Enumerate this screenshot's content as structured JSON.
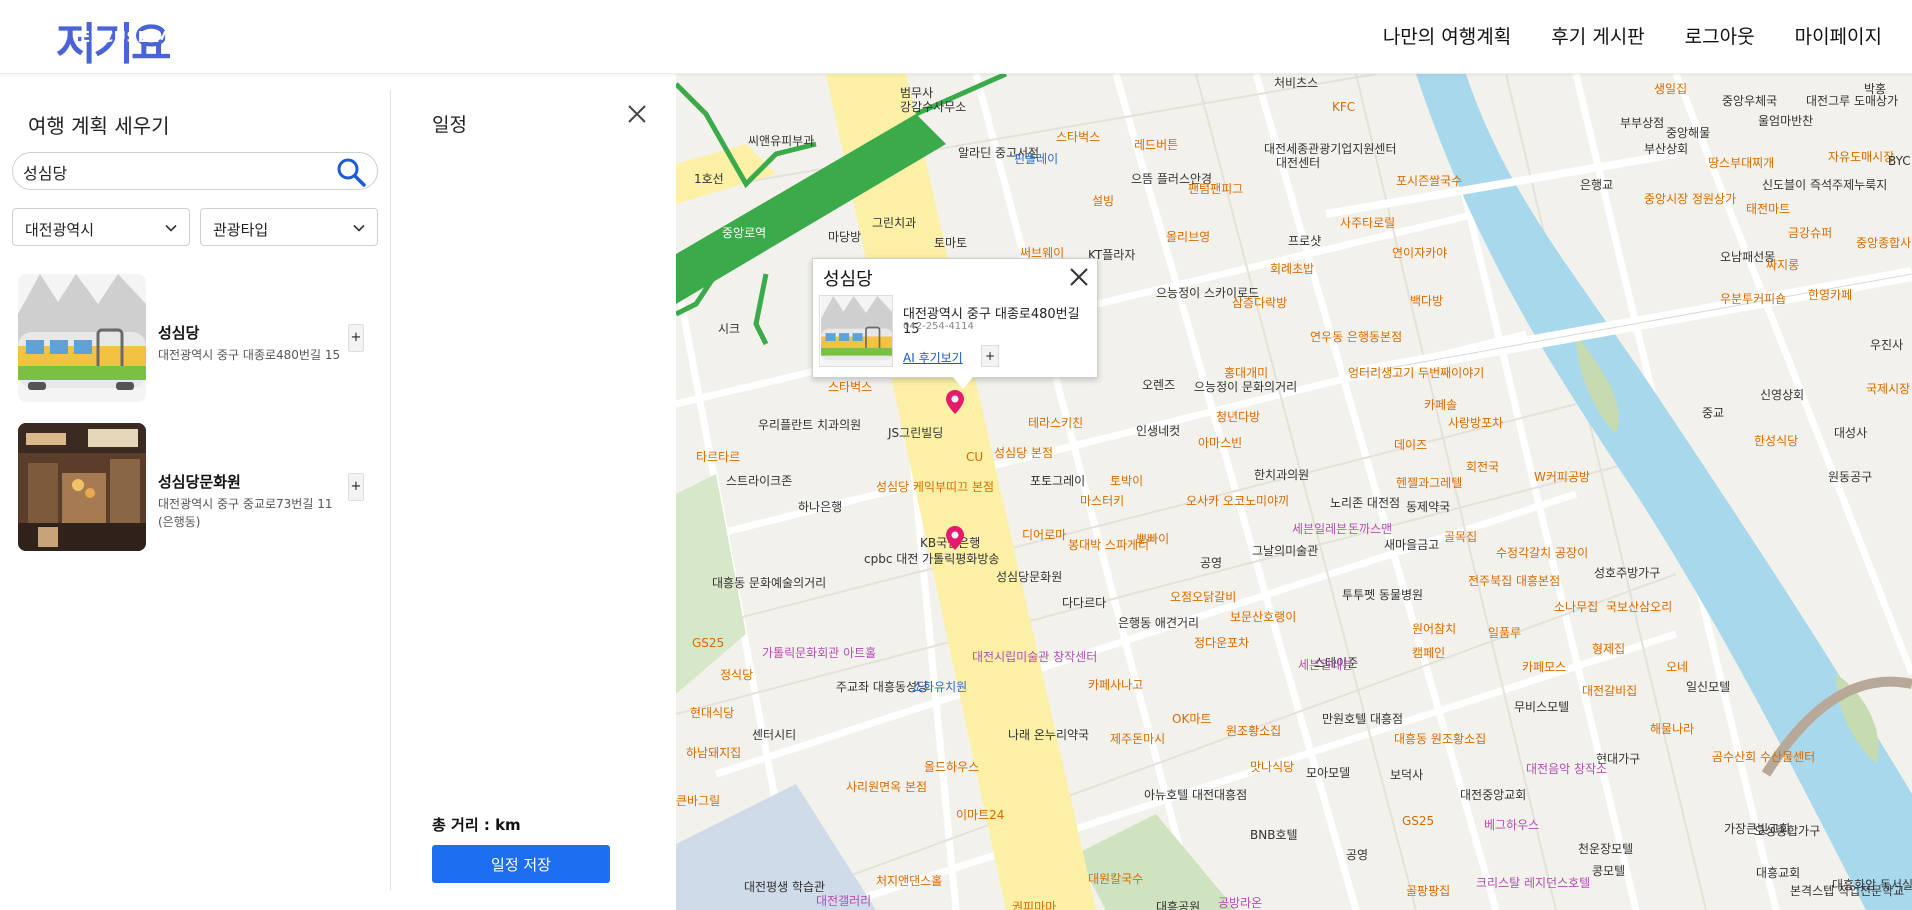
{
  "header": {
    "logo_ko": "저기요",
    "logo_en": "EXCUSE ME",
    "nav": [
      "나만의 여행계획",
      "후기 게시판",
      "로그아웃",
      "마이페이지"
    ]
  },
  "left_panel": {
    "title": "여행 계획 세우기",
    "search_value": "성심당",
    "region_select": "대전광역시",
    "type_select": "관광타입",
    "results": [
      {
        "name": "성심당",
        "address": "대전광역시 중구 대종로480번길 15",
        "add_label": "+"
      },
      {
        "name": "성심당문화원",
        "address": "대전광역시 중구 중교로73번길 11 (은행동)",
        "add_label": "+"
      }
    ]
  },
  "schedule": {
    "title": "일정",
    "total_distance": "총 거리 : km",
    "save_label": "일정 저장"
  },
  "popup": {
    "title": "성심당",
    "address": "대전광역시 중구 대종로480번길 15",
    "phone": "042-254-4114",
    "review_link": "AI 후기보기",
    "add_label": "+"
  },
  "map_labels": {
    "stations": [
      "중앙로역",
      "1호선"
    ],
    "places": [
      "범무사",
      "강감수사무소",
      "씨앤유피부과",
      "알라딘 중고서점",
      "핀플레이",
      "스타벅스",
      "레드버튼",
      "으뜸 플러스안경",
      "팬텀팬피그",
      "설빙",
      "올리브영",
      "써브웨이",
      "KT플라자",
      "프로샷",
      "처비츠스",
      "KFC",
      "대전세종관광기업지원센터",
      "대전센터",
      "포시즌쌀국수",
      "사주타로릴",
      "회례초밥",
      "연이자카야",
      "백다방",
      "으능정이 스카이로드",
      "삼층다락방",
      "연우동 은행동본점",
      "그린치과",
      "토마토",
      "마당방",
      "시크",
      "우리플란트 치과의원",
      "JS그린빌딩",
      "스타벅스",
      "타르타르",
      "스트라이크존",
      "하나은행",
      "CU",
      "성심당 본점",
      "성심당 케익부띠끄 본점",
      "테라스키친",
      "인생네컷",
      "포토그레이",
      "토박이",
      "마스터키",
      "디어로마",
      "봉대박 스파게티",
      "뽀빠이",
      "오사카 오코노미야끼",
      "한치과의원",
      "노리존 대전점",
      "세븐일레븐",
      "돈까스맨",
      "동제약국",
      "새마을금고",
      "골목집",
      "수정각갈치 공장이",
      "KB국민은행",
      "cpbc 대전 가톨릭평화방송",
      "성심당문화원",
      "다다르다",
      "그날의미술관",
      "공영",
      "오렌즈",
      "으능정이 문화의거리",
      "홍대개미",
      "청년다방",
      "아마스빈",
      "엉터리생고기 두번째이야기",
      "카페솔",
      "사랑방포차",
      "데이즈",
      "회전국",
      "헨젤과그레텔",
      "W커피공방",
      "대흥동 문화예술의거리",
      "GS25",
      "정식당",
      "가톨릭문화회관 아트홀",
      "주교좌 대흥동성당",
      "현대식당",
      "센터시티",
      "하남돼지집",
      "큰바그릴",
      "사리원면옥 본점",
      "올드하우스",
      "이마트24",
      "소화유치원",
      "대전시립미술관 창작센터",
      "나래 온누리약국",
      "카페사나고",
      "제주돈마시",
      "OK마트",
      "원조황소집",
      "맛나식당",
      "모아모델",
      "만원호텔 대흥점",
      "보덕사",
      "대흥동 원조황소집",
      "대전중앙교회",
      "대전음악 창작소",
      "현대가구",
      "아뉴호텔 대전대흥점",
      "BNB호텔",
      "공영",
      "GS25",
      "베그하우스",
      "천운장모텔",
      "콩모텔",
      "가장큰빛교회",
      "오성종합가구",
      "대전평생 학습관",
      "대전갤러리",
      "처지앤댄스홀",
      "권피마마",
      "대원칼국수",
      "대흥공원",
      "공방라온",
      "골팡팡집",
      "크리스탈 레지던스호텔",
      "대흥교회",
      "본격스텝 직업전문학교",
      "대흥화암 독서실",
      "은행동 애견거리",
      "정다운포차",
      "보문산호랭이",
      "오점오닭갈비",
      "투투펫 동물병원",
      "원어참치",
      "캠페인",
      "스테이준",
      "세븐일레븐",
      "카페모스",
      "형제집",
      "대전갈비집",
      "오네",
      "일신모텔",
      "무비스모텔",
      "해물나라",
      "곰수산회 수산물센터",
      "소나무집",
      "국보산삼오리",
      "성호주방가구",
      "일품루",
      "전주북집 대흥본점",
      "생일집",
      "중앙우체국",
      "중앙해물",
      "부산상회",
      "부부상점",
      "울엄마반찬",
      "중앙시장 정원상가",
      "태전마트",
      "자유도매시장",
      "땅스부대찌개",
      "신도블이 즉석주제누룩지",
      "오남패선몽",
      "싸지롱",
      "금강슈퍼",
      "한영카페",
      "중앙종합사",
      "우분투커피숍",
      "신영상회",
      "한성식당",
      "대성사",
      "원동공구",
      "국제시장",
      "우진사",
      "은행교",
      "중교",
      "대전그루 도매상가",
      "박홍",
      "BYC"
    ]
  },
  "colors": {
    "accent": "#1d6ef0",
    "logo": "#4a63d6",
    "river": "#a8d8ec",
    "major_road": "#fbf0a6",
    "subway": "#3aaa4a",
    "pin": "#e8196c"
  }
}
